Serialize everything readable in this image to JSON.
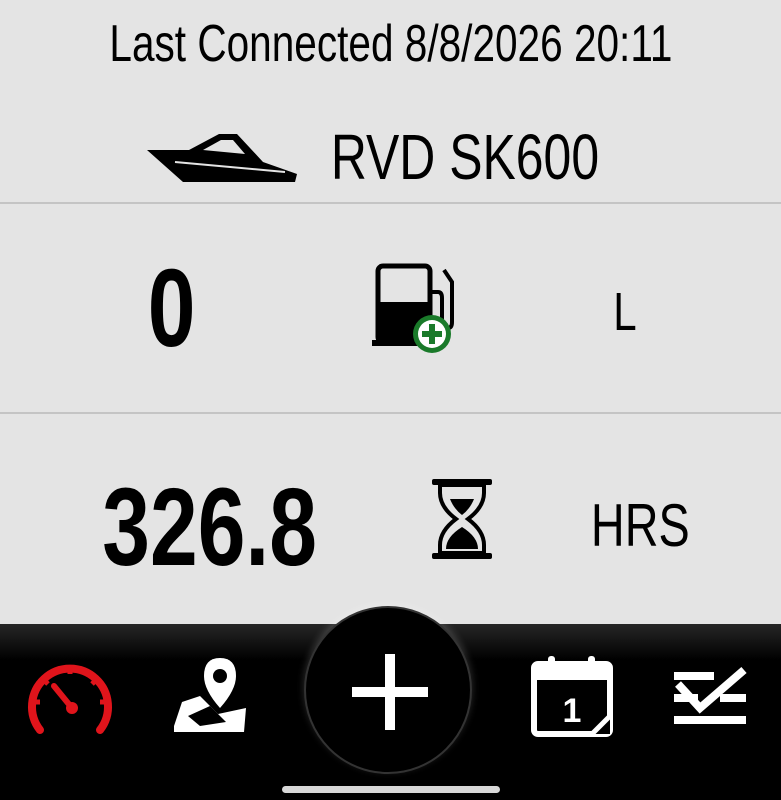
{
  "header": {
    "last_connected": "Last Connected 8/8/2026 20:11",
    "boat_name": "RVD SK600",
    "boat_icon": "boat-icon"
  },
  "fuel": {
    "value": "0",
    "unit": "L",
    "icon": "fuel-pump-add-icon",
    "icon_accent": "#1a7a2a"
  },
  "hours": {
    "value": "326.8",
    "unit": "HRS",
    "icon": "hourglass-icon"
  },
  "nav": {
    "items": [
      {
        "icon": "speedometer-icon",
        "color": "#e0141b"
      },
      {
        "icon": "map-pin-icon",
        "color": "#ffffff"
      },
      {
        "icon": "plus-icon",
        "color": "#ffffff"
      },
      {
        "icon": "calendar-icon",
        "label": "1",
        "color": "#ffffff"
      },
      {
        "icon": "checklist-icon",
        "color": "#ffffff"
      }
    ]
  }
}
